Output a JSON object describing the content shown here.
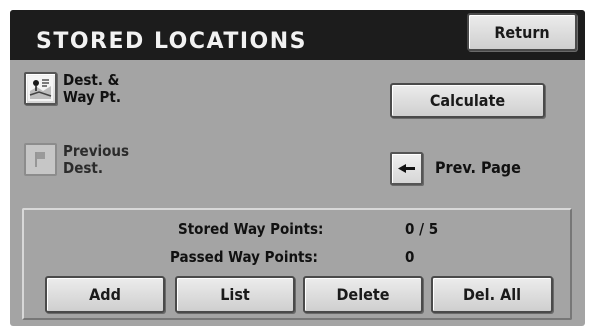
{
  "header": {
    "title": "STORED LOCATIONS",
    "return_label": "Return"
  },
  "options": {
    "dest_waypoint": {
      "icon": "map-waypoint-icon",
      "label_line1": "Dest. &",
      "label_line2": "Way Pt."
    },
    "previous_dest": {
      "icon": "flag-icon",
      "label_line1": "Previous",
      "label_line2": "Dest."
    }
  },
  "actions": {
    "calculate_label": "Calculate",
    "prev_page_label": "Prev. Page",
    "prev_page_icon": "left-arrow-icon"
  },
  "waypoints": {
    "stored_label": "Stored Way Points:",
    "stored_value": "0 / 5",
    "passed_label": "Passed Way Points:",
    "passed_value": "0"
  },
  "bottom_buttons": {
    "add": "Add",
    "list": "List",
    "delete": "Delete",
    "del_all": "Del. All"
  },
  "colors": {
    "background": "#a4a4a4",
    "titlebar": "#1c1c1c",
    "button": "#e0e0e0"
  }
}
